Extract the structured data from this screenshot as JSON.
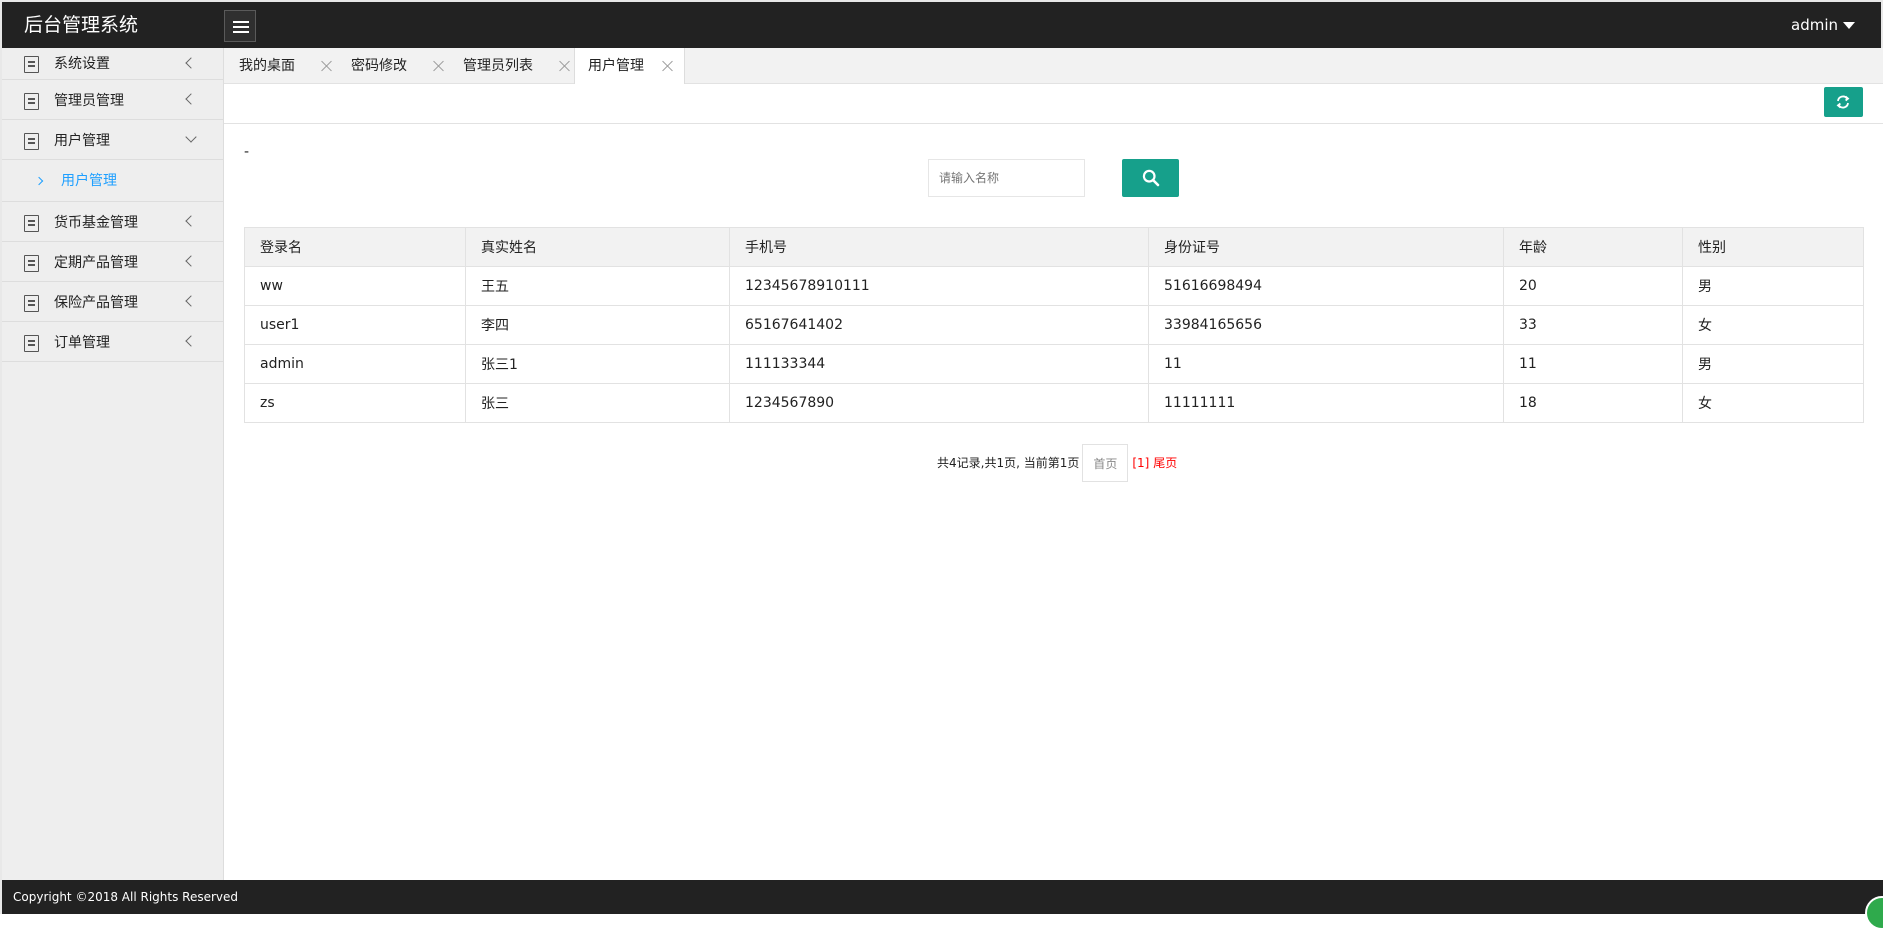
{
  "header": {
    "title": "后台管理系统",
    "user": "admin"
  },
  "sidebar": {
    "items": [
      {
        "label": "系统设置"
      },
      {
        "label": "管理员管理"
      },
      {
        "label": "用户管理",
        "expanded": true,
        "children": [
          {
            "label": "用户管理"
          }
        ]
      },
      {
        "label": "货币基金管理"
      },
      {
        "label": "定期产品管理"
      },
      {
        "label": "保险产品管理"
      },
      {
        "label": "订单管理"
      }
    ]
  },
  "tabs": [
    {
      "label": "我的桌面"
    },
    {
      "label": "密码修改"
    },
    {
      "label": "管理员列表"
    },
    {
      "label": "用户管理",
      "active": true
    }
  ],
  "main": {
    "dash": "-",
    "search": {
      "placeholder": "请输入名称"
    },
    "table": {
      "headers": [
        "登录名",
        "真实姓名",
        "手机号",
        "身份证号",
        "年龄",
        "性别"
      ],
      "rows": [
        [
          "ww",
          "王五",
          "12345678910111",
          "51616698494",
          "20",
          "男"
        ],
        [
          "user1",
          "李四",
          "65167641402",
          "33984165656",
          "33",
          "女"
        ],
        [
          "admin",
          "张三1",
          "111133344",
          "11",
          "11",
          "男"
        ],
        [
          "zs",
          "张三",
          "1234567890",
          "11111111",
          "18",
          "女"
        ]
      ]
    },
    "pager": {
      "summary": "共4记录,共1页, 当前第1页",
      "first": "首页",
      "current": "[1]",
      "last": "尾页"
    }
  },
  "footer": {
    "copyright": "Copyright ©2018 All Rights Reserved"
  },
  "icons": {
    "menu": "hamburger-icon",
    "refresh": "refresh-icon",
    "search": "search-icon",
    "close": "close-icon",
    "nav": "document-icon"
  },
  "colors": {
    "header_bg": "#222222",
    "primary": "#16a08b",
    "sidebar_bg": "#eeeeee",
    "active_link": "#1e9fff",
    "pager_red": "#ff0000"
  }
}
